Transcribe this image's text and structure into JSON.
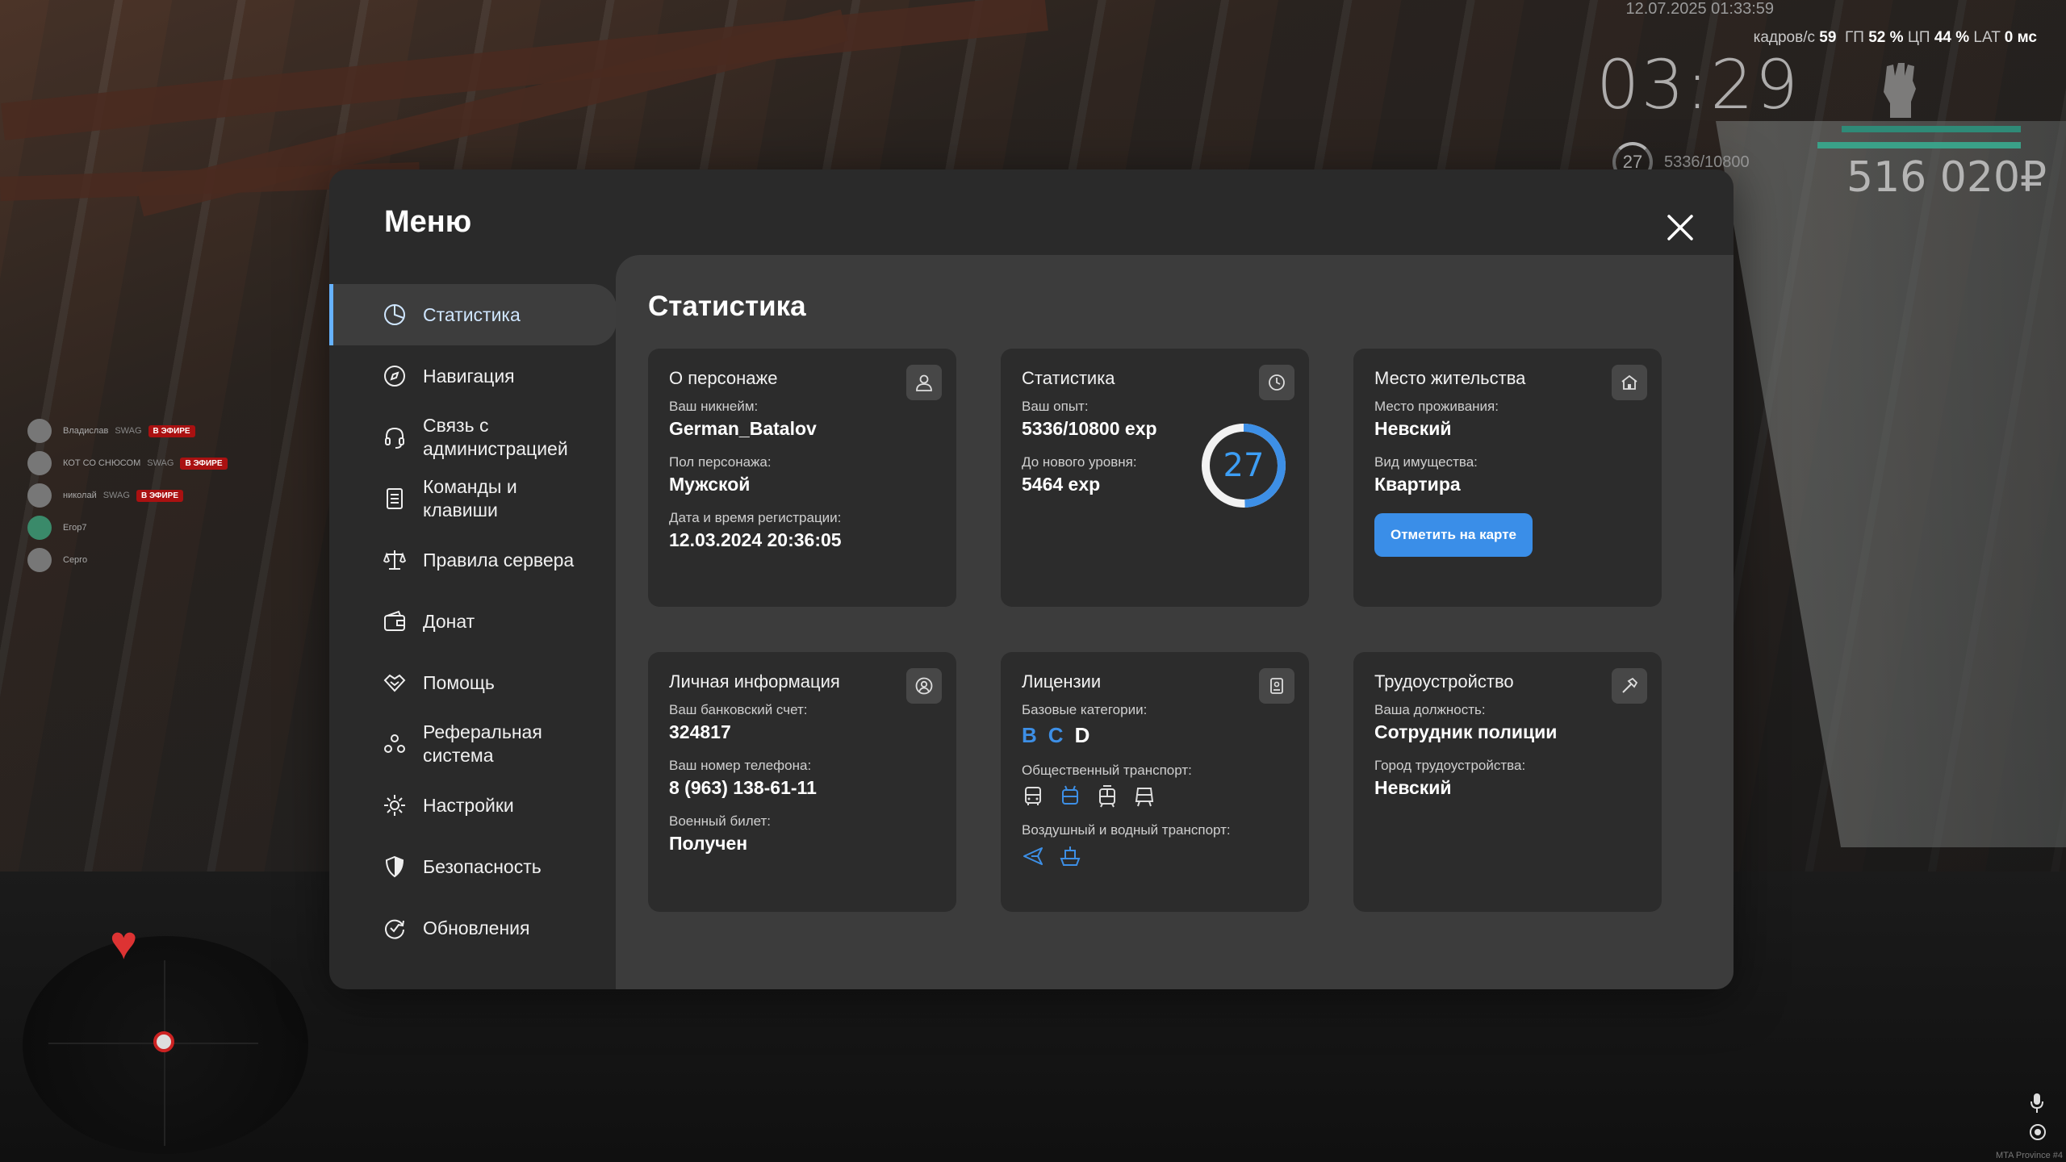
{
  "hud": {
    "datetime": "12.07.2025 01:33:59",
    "fps_label": "кадров/с",
    "fps_value": "59",
    "gpu_label": "ГП",
    "gpu_value": "52 %",
    "cpu_label": "ЦП",
    "cpu_value": "44 %",
    "lat_label": "LAT",
    "lat_value": "0 мс",
    "time": "03:29",
    "level": "27",
    "exp": "5336/10800",
    "money": "516 020₽",
    "server": "MTA Province #4"
  },
  "voice_chat": [
    {
      "name": "Владислав",
      "tag": "SWAG",
      "live": "В ЭФИРЕ"
    },
    {
      "name": "КОТ СО СНЮСОМ",
      "tag": "SWAG",
      "live": "В ЭФИРЕ"
    },
    {
      "name": "николай",
      "tag": "SWAG",
      "live": "В ЭФИРЕ"
    },
    {
      "name": "Егор7",
      "tag": "",
      "live": ""
    },
    {
      "name": "Серго",
      "tag": "",
      "live": ""
    }
  ],
  "menu": {
    "title": "Меню",
    "sidebar": [
      {
        "label": "Статистика",
        "icon": "pie-chart-icon",
        "active": true
      },
      {
        "label": "Навигация",
        "icon": "compass-icon"
      },
      {
        "label": "Связь с администрацией",
        "icon": "headset-icon"
      },
      {
        "label": "Команды и клавиши",
        "icon": "document-icon"
      },
      {
        "label": "Правила сервера",
        "icon": "scales-icon"
      },
      {
        "label": "Донат",
        "icon": "wallet-icon"
      },
      {
        "label": "Помощь",
        "icon": "handshake-icon"
      },
      {
        "label": "Реферальная система",
        "icon": "people-icon"
      },
      {
        "label": "Настройки",
        "icon": "gear-icon"
      },
      {
        "label": "Безопасность",
        "icon": "shield-icon"
      },
      {
        "label": "Обновления",
        "icon": "refresh-check-icon"
      }
    ],
    "content_title": "Статистика",
    "cards": {
      "character": {
        "title": "О персонаже",
        "nick_label": "Ваш никнейм:",
        "nick": "German_Batalov",
        "gender_label": "Пол персонажа:",
        "gender": "Мужской",
        "reg_label": "Дата и время регистрации:",
        "reg": "12.03.2024 20:36:05"
      },
      "stats": {
        "title": "Статистика",
        "exp_label": "Ваш опыт:",
        "exp": "5336/10800 exp",
        "next_label": "До нового уровня:",
        "next": "5464 exp",
        "level": "27",
        "progress": 0.494
      },
      "residence": {
        "title": "Место жительства",
        "place_label": "Место проживания:",
        "place": "Невский",
        "property_label": "Вид имущества:",
        "property": "Квартира",
        "button": "Отметить на карте"
      },
      "personal": {
        "title": "Личная информация",
        "bank_label": "Ваш банковский счет:",
        "bank": "324817",
        "phone_label": "Ваш номер телефона:",
        "phone": "8 (963) 138-61-11",
        "military_label": "Военный билет:",
        "military": "Получен"
      },
      "licenses": {
        "title": "Лицензии",
        "base_label": "Базовые категории:",
        "categories": [
          "B",
          "C",
          "D"
        ],
        "public_label": "Общественный транспорт:",
        "air_label": "Воздушный и водный транспорт:"
      },
      "job": {
        "title": "Трудоустройство",
        "position_label": "Ваша должность:",
        "position": "Сотрудник полиции",
        "city_label": "Город трудоустройства:",
        "city": "Невский"
      }
    }
  },
  "colors": {
    "accent": "#3a8ee8",
    "ring": "#3d9ef5",
    "panel": "#2a2a2a",
    "content": "#3c3c3c",
    "card": "#2c2c2c"
  }
}
